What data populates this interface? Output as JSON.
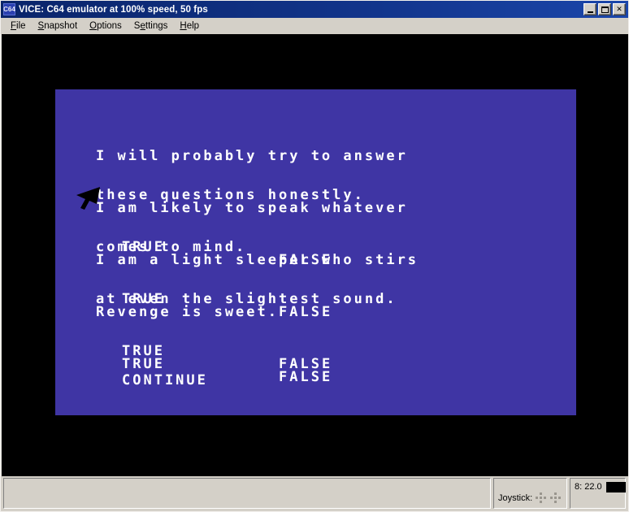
{
  "window": {
    "title": "VICE: C64 emulator at 100% speed, 50 fps",
    "icon": "vice-app-icon",
    "buttons": {
      "minimize": "minimize-button",
      "maximize": "maximize-button",
      "close": "✕"
    }
  },
  "menu": {
    "items": [
      {
        "label": "File",
        "mnemonic": "F",
        "rest": "ile"
      },
      {
        "label": "Snapshot",
        "mnemonic": "S",
        "rest": "napshot",
        "pre": ""
      },
      {
        "label": "Options",
        "mnemonic": "O",
        "rest": "ptions"
      },
      {
        "label": "Settings",
        "mnemonic": "e",
        "rest": "ttings",
        "pre": "S"
      },
      {
        "label": "Help",
        "mnemonic": "H",
        "rest": "elp"
      }
    ]
  },
  "screen": {
    "background_color": "#3f35a4",
    "text_color": "#ffffff",
    "border_color": "#000000",
    "answer_true": "TRUE",
    "answer_false": "FALSE",
    "continue_label": "CONTINUE",
    "questions": [
      {
        "line1": "I will probably try to answer",
        "line2": "these questions honestly.",
        "true_label": "TRUE",
        "false_label": "FALSE"
      },
      {
        "line1": "I am likely to speak whatever",
        "line2": "comes to mind.",
        "true_label": "TRUE",
        "false_label": "FALSE"
      },
      {
        "line1": "I am a light sleeper who stirs",
        "line2": "at even the slightest sound.",
        "true_label": "TRUE",
        "false_label": "FALSE"
      },
      {
        "line1": "Revenge is sweet.",
        "line2": "",
        "true_label": "TRUE",
        "false_label": "FALSE"
      }
    ]
  },
  "cursor": {
    "name": "mouse-pointer-arrow",
    "color": "#000000"
  },
  "status_bar": {
    "speed_panel": "",
    "joystick_label": "Joystick:",
    "drive_status": "8: 22.0",
    "drive_led_color": "#000000"
  }
}
